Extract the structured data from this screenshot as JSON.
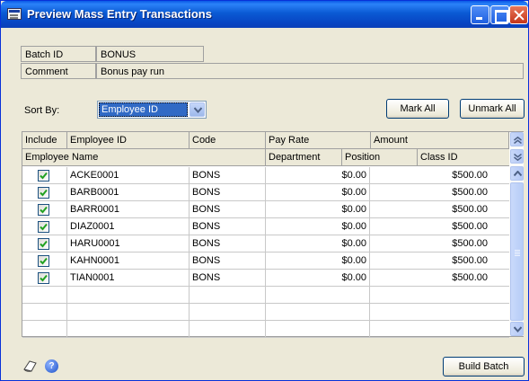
{
  "window": {
    "title": "Preview Mass Entry Transactions"
  },
  "info": {
    "batch_id_label": "Batch ID",
    "batch_id_value": "BONUS",
    "comment_label": "Comment",
    "comment_value": "Bonus pay run"
  },
  "sort": {
    "label": "Sort By:",
    "selected": "Employee ID"
  },
  "buttons": {
    "mark_all": "Mark All",
    "unmark_all": "Unmark All",
    "build_batch": "Build Batch"
  },
  "grid": {
    "header1": [
      "Include",
      "Employee ID",
      "Code",
      "Pay Rate",
      "Amount"
    ],
    "header2": [
      "Employee Name",
      "Department",
      "Position",
      "Class ID"
    ],
    "rows": [
      {
        "include": true,
        "employee_id": "ACKE0001",
        "code": "BONS",
        "pay_rate": "$0.00",
        "amount": "$500.00"
      },
      {
        "include": true,
        "employee_id": "BARB0001",
        "code": "BONS",
        "pay_rate": "$0.00",
        "amount": "$500.00"
      },
      {
        "include": true,
        "employee_id": "BARR0001",
        "code": "BONS",
        "pay_rate": "$0.00",
        "amount": "$500.00"
      },
      {
        "include": true,
        "employee_id": "DIAZ0001",
        "code": "BONS",
        "pay_rate": "$0.00",
        "amount": "$500.00"
      },
      {
        "include": true,
        "employee_id": "HARU0001",
        "code": "BONS",
        "pay_rate": "$0.00",
        "amount": "$500.00"
      },
      {
        "include": true,
        "employee_id": "KAHN0001",
        "code": "BONS",
        "pay_rate": "$0.00",
        "amount": "$500.00"
      },
      {
        "include": true,
        "employee_id": "TIAN0001",
        "code": "BONS",
        "pay_rate": "$0.00",
        "amount": "$500.00"
      }
    ],
    "empty_rows": 3
  },
  "colors": {
    "titlebar": "#0a5ad4",
    "selection": "#316ac5",
    "checkmark": "#21a121",
    "face": "#ece9d8"
  }
}
